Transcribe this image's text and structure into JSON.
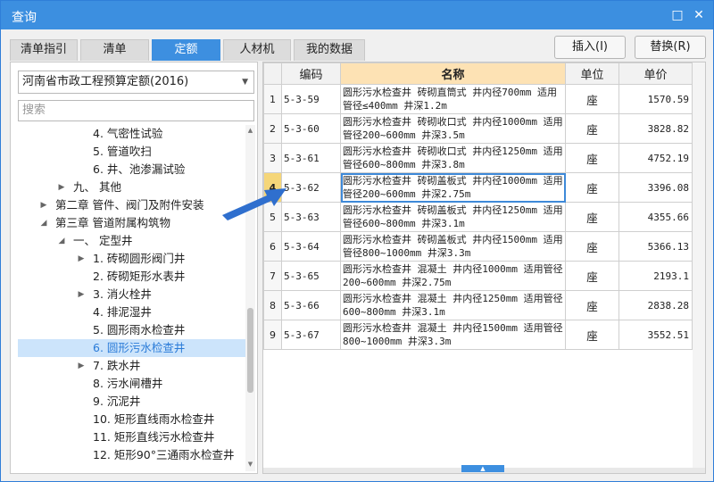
{
  "window": {
    "title": "查询",
    "maximize_icon": "maximize-icon",
    "close_icon": "close-icon"
  },
  "tabs": [
    {
      "label": "清单指引",
      "active": false
    },
    {
      "label": "清单",
      "active": false
    },
    {
      "label": "定额",
      "active": true
    },
    {
      "label": "人材机",
      "active": false
    },
    {
      "label": "我的数据",
      "active": false
    }
  ],
  "actions": {
    "insert_label": "插入(I)",
    "replace_label": "替换(R)"
  },
  "library": {
    "selected": "河南省市政工程预算定额(2016)"
  },
  "search": {
    "placeholder": "搜索",
    "value": ""
  },
  "tree": [
    {
      "label": "4. 气密性试验",
      "caret": ""
    },
    {
      "label": "5. 管道吹扫",
      "caret": ""
    },
    {
      "label": "6. 井、池渗漏试验",
      "caret": ""
    },
    {
      "label": "九、 其他",
      "caret": "right"
    },
    {
      "label": "第二章 管件、阀门及附件安装",
      "caret": "right"
    },
    {
      "label": "第三章 管道附属构筑物",
      "caret": "down"
    },
    {
      "label": "一、 定型井",
      "caret": "down"
    },
    {
      "label": "1. 砖砌圆形阀门井",
      "caret": "right"
    },
    {
      "label": "2. 砖砌矩形水表井",
      "caret": ""
    },
    {
      "label": "3. 消火栓井",
      "caret": "right"
    },
    {
      "label": "4. 排泥湿井",
      "caret": ""
    },
    {
      "label": "5. 圆形雨水检查井",
      "caret": ""
    },
    {
      "label": "6. 圆形污水检查井",
      "caret": "",
      "selected": true
    },
    {
      "label": "7. 跌水井",
      "caret": "right"
    },
    {
      "label": "8. 污水闸槽井",
      "caret": ""
    },
    {
      "label": "9. 沉泥井",
      "caret": ""
    },
    {
      "label": "10. 矩形直线雨水检查井",
      "caret": ""
    },
    {
      "label": "11. 矩形直线污水检查井",
      "caret": ""
    },
    {
      "label": "12. 矩形90°三通雨水检查井",
      "caret": ""
    }
  ],
  "grid": {
    "headers": {
      "code": "编码",
      "name": "名称",
      "unit": "单位",
      "price": "单价"
    },
    "current_row": 4,
    "rows": [
      {
        "rn": "1",
        "code": "5-3-59",
        "name": "圆形污水检查井 砖砌直筒式 井内径700mm 适用管径≤400mm 井深1.2m",
        "unit": "座",
        "price": "1570.59"
      },
      {
        "rn": "2",
        "code": "5-3-60",
        "name": "圆形污水检查井 砖砌收口式 井内径1000mm 适用管径200~600mm 井深3.5m",
        "unit": "座",
        "price": "3828.82"
      },
      {
        "rn": "3",
        "code": "5-3-61",
        "name": "圆形污水检查井 砖砌收口式 井内径1250mm 适用管径600~800mm 井深3.8m",
        "unit": "座",
        "price": "4752.19"
      },
      {
        "rn": "4",
        "code": "5-3-62",
        "name": "圆形污水检查井 砖砌盖板式 井内径1000mm 适用管径200~600mm 井深2.75m",
        "unit": "座",
        "price": "3396.08"
      },
      {
        "rn": "5",
        "code": "5-3-63",
        "name": "圆形污水检查井 砖砌盖板式 井内径1250mm 适用管径600~800mm 井深3.1m",
        "unit": "座",
        "price": "4355.66"
      },
      {
        "rn": "6",
        "code": "5-3-64",
        "name": "圆形污水检查井 砖砌盖板式 井内径1500mm 适用管径800~1000mm 井深3.3m",
        "unit": "座",
        "price": "5366.13"
      },
      {
        "rn": "7",
        "code": "5-3-65",
        "name": "圆形污水检查井 混凝土 井内径1000mm 适用管径200~600mm 井深2.75m",
        "unit": "座",
        "price": "2193.1"
      },
      {
        "rn": "8",
        "code": "5-3-66",
        "name": "圆形污水检查井 混凝土 井内径1250mm 适用管径600~800mm 井深3.1m",
        "unit": "座",
        "price": "2838.28"
      },
      {
        "rn": "9",
        "code": "5-3-67",
        "name": "圆形污水检查井 混凝土 井内径1500mm 适用管径800~1000mm 井深3.3m",
        "unit": "座",
        "price": "3552.51"
      }
    ]
  },
  "colors": {
    "accent": "#3d8fe0",
    "selected_row": "#cce4fb",
    "name_header": "#fde2b4",
    "arrow": "#2f6fce"
  }
}
